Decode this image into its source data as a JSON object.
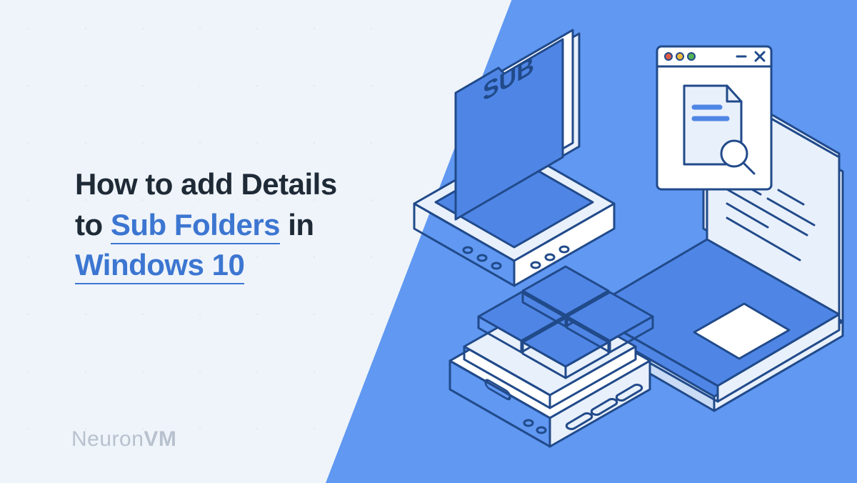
{
  "headline": {
    "part1": "How to add Details",
    "part2": "to",
    "highlight1": "Sub Folders",
    "part3": "in",
    "highlight2": "Windows 10"
  },
  "brand": {
    "left": "Neuron",
    "right": "VM"
  },
  "illustration": {
    "folder_label": "SUB"
  },
  "colors": {
    "accent": "#3c76d1",
    "bg_blue": "#6098f2",
    "bg_light": "#eff4fa",
    "dark": "#1f2a37",
    "stroke": "#214a8a",
    "fill_blue": "#4f86e6",
    "fill_light": "#ffffff",
    "fill_pale": "#e8f0fb"
  }
}
